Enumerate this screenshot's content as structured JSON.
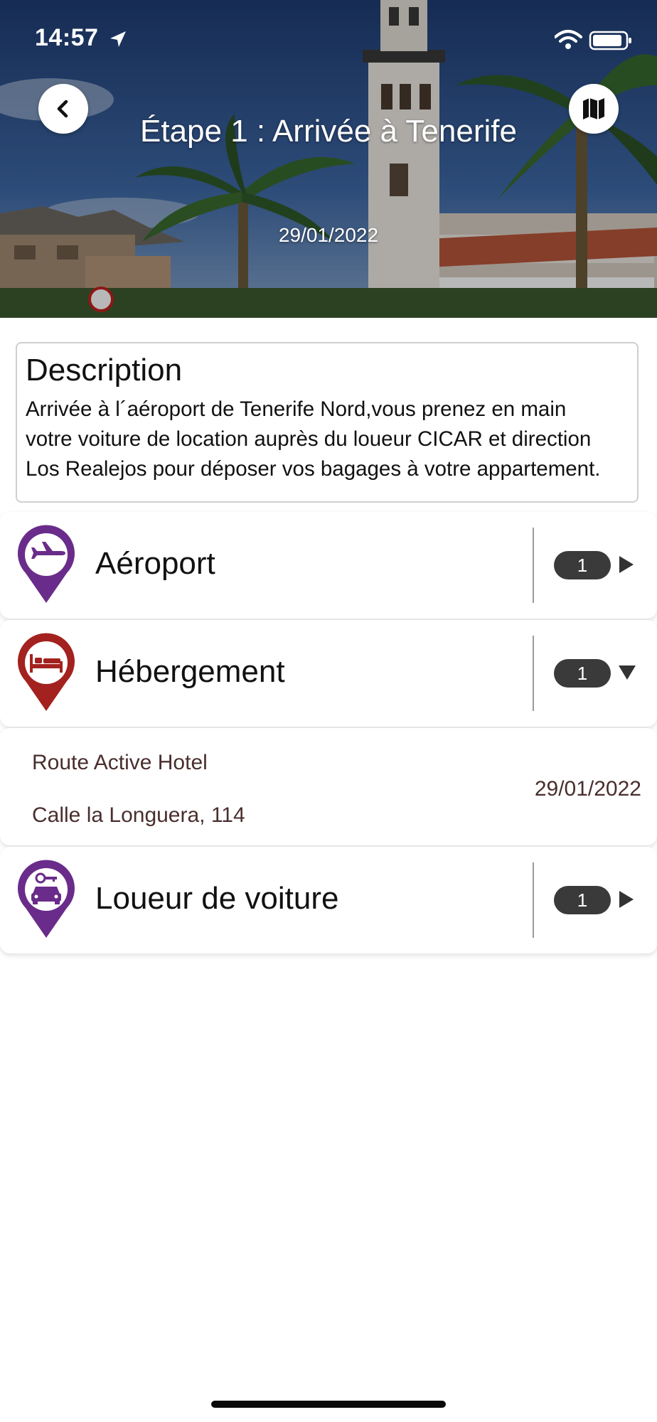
{
  "status_bar": {
    "time": "14:57"
  },
  "header": {
    "title": "Étape 1 : Arrivée à Tenerife",
    "date": "29/01/2022"
  },
  "description": {
    "heading": "Description",
    "lines": [
      "Arrivée à l´aéroport de Tenerife Nord,vous prenez en main",
      "votre voiture de location auprès du loueur CICAR et direction",
      "Los Realejos pour déposer vos bagages à votre appartement."
    ]
  },
  "categories": [
    {
      "label": "Aéroport",
      "count": "1",
      "state": "collapsed",
      "icon": "airplane-icon",
      "color": "#6a2c8a"
    },
    {
      "label": "Hébergement",
      "count": "1",
      "state": "expanded",
      "icon": "bed-icon",
      "color": "#a3221f"
    },
    {
      "label": "Loueur de voiture",
      "count": "1",
      "state": "collapsed",
      "icon": "car-rental-icon",
      "color": "#6a2c8a"
    }
  ],
  "accommodation_item": {
    "name": "Route Active Hotel",
    "address": "Calle la Longuera, 114",
    "date": "29/01/2022"
  },
  "colors": {
    "purple_accent": "#6a2c8a",
    "red_accent": "#a3221f",
    "badge_bg": "#3a3a3a"
  }
}
